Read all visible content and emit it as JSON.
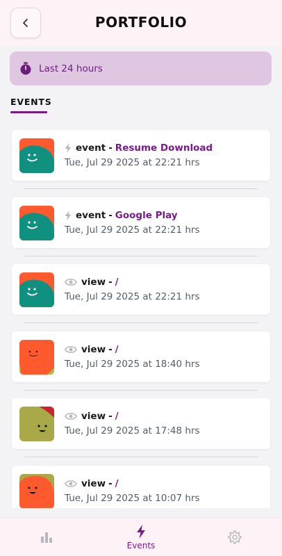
{
  "header": {
    "title": "PORTFOLIO",
    "back_icon": "chevron-left-icon"
  },
  "filter": {
    "icon": "stopwatch-icon",
    "label": "Last 24 hours"
  },
  "section": {
    "title": "EVENTS"
  },
  "events": [
    {
      "icon": "bolt-icon",
      "kind": "event",
      "target": "Resume Download",
      "time": "Tue, Jul 29 2025 at 22:21 hrs",
      "avatar": "teal-orange"
    },
    {
      "icon": "bolt-icon",
      "kind": "event",
      "target": "Google Play",
      "time": "Tue, Jul 29 2025 at 22:21 hrs",
      "avatar": "teal-orange"
    },
    {
      "icon": "eye-icon",
      "kind": "view",
      "target": "/",
      "time": "Tue, Jul 29 2025 at 22:21 hrs",
      "avatar": "teal-orange"
    },
    {
      "icon": "eye-icon",
      "kind": "view",
      "target": "/",
      "time": "Tue, Jul 29 2025 at 18:40 hrs",
      "avatar": "orange-green"
    },
    {
      "icon": "eye-icon",
      "kind": "view",
      "target": "/",
      "time": "Tue, Jul 29 2025 at 17:48 hrs",
      "avatar": "olive-red"
    },
    {
      "icon": "eye-icon",
      "kind": "view",
      "target": "/",
      "time": "Tue, Jul 29 2025 at 10:07 hrs",
      "avatar": "olive-orange"
    }
  ],
  "tabs": [
    {
      "name": "stats",
      "icon": "bar-chart-icon",
      "label": "",
      "active": false
    },
    {
      "name": "events",
      "icon": "bolt-icon",
      "label": "Events",
      "active": true
    },
    {
      "name": "settings",
      "icon": "gear-icon",
      "label": "",
      "active": false
    }
  ],
  "colors": {
    "accent": "#7a1b8c",
    "filter_bg": "#dfc7e2",
    "header_bg": "#fdf3f6"
  }
}
